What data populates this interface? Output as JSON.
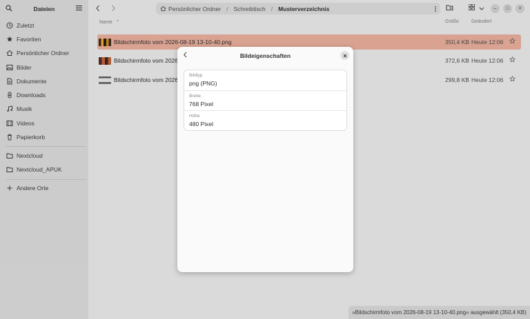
{
  "sidebar": {
    "title": "Dateien",
    "places": [
      {
        "label": "Zuletzt",
        "icon": "clock-icon"
      },
      {
        "label": "Favoriten",
        "icon": "star-icon"
      },
      {
        "label": "Persönlicher Ordner",
        "icon": "home-icon"
      },
      {
        "label": "Bilder",
        "icon": "image-icon"
      },
      {
        "label": "Dokumente",
        "icon": "document-icon"
      },
      {
        "label": "Downloads",
        "icon": "download-icon"
      },
      {
        "label": "Musik",
        "icon": "music-icon"
      },
      {
        "label": "Videos",
        "icon": "video-icon"
      },
      {
        "label": "Papierkorb",
        "icon": "trash-icon"
      }
    ],
    "network": [
      {
        "label": "Nextcloud",
        "icon": "folder-icon"
      },
      {
        "label": "Nextcloud_APUK",
        "icon": "folder-icon"
      }
    ],
    "other": {
      "label": "Andere Orte",
      "icon": "plus-icon"
    }
  },
  "pathbar": {
    "crumbs": [
      "Persönlicher Ordner",
      "Schreibtisch",
      "Musterverzeichnis"
    ],
    "separator": "/"
  },
  "columns": {
    "name": "Name",
    "size": "Größe",
    "modified": "Geändert"
  },
  "files": [
    {
      "name": "Bildschirmfoto vom 2026-08-19 13-10-40.png",
      "size": "350,4 KB",
      "date": "Heute 12:06",
      "selected": true
    },
    {
      "name": "Bildschirmfoto vom 2026-0",
      "size": "372,6 KB",
      "date": "Heute 12:06",
      "selected": false
    },
    {
      "name": "Bildschirmfoto vom 2026-0",
      "size": "299,8 KB",
      "date": "Heute 12:06",
      "selected": false
    }
  ],
  "dialog": {
    "title": "Bildeigenschaften",
    "properties": [
      {
        "label": "Bildtyp",
        "value": "png (PNG)"
      },
      {
        "label": "Breite",
        "value": "768 Pixel"
      },
      {
        "label": "Höhe",
        "value": "480 Pixel"
      }
    ]
  },
  "statusbar": {
    "text": "»Bildschirmfoto vom 2026-08-19 13-10-40.png« ausgewählt  (350,4 KB)"
  },
  "colors": {
    "selection": "#e1a897",
    "sidebar": "#d4d4d4",
    "main": "#e2e2e2",
    "dialog": "#fafafa"
  }
}
